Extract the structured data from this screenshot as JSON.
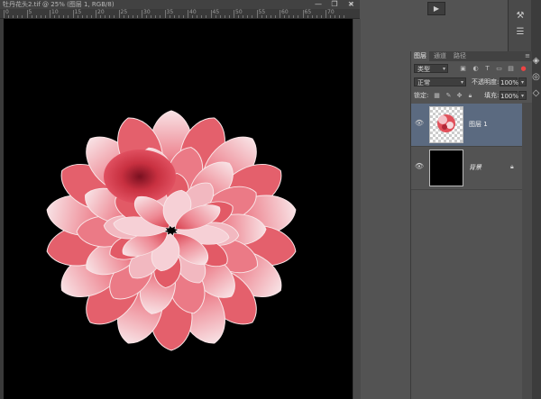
{
  "document": {
    "title": "牡丹花头2.tif @ 25% (图层 1, RGB/8)",
    "ruler_top_labels": [
      "0",
      "5",
      "10",
      "15",
      "20",
      "25",
      "30",
      "35",
      "40",
      "45",
      "50",
      "55",
      "60",
      "65",
      "70"
    ],
    "close_glyph": "×"
  },
  "window_controls": {
    "minimize": "—",
    "restore": "❐",
    "close": "✕"
  },
  "toolbar": {
    "play_glyph": "▶"
  },
  "layers_panel": {
    "tabs": [
      "图层",
      "通道",
      "路径"
    ],
    "active_tab": "图层",
    "menu_glyph": "≡",
    "filter": {
      "kind_label": "类型",
      "icons": [
        "image-filter-icon",
        "adjustment-filter-icon",
        "type-filter-icon",
        "shape-filter-icon",
        "smart-object-filter-icon"
      ]
    },
    "blend_mode": "正常",
    "opacity": {
      "label": "不透明度:",
      "value": "100%"
    },
    "lock": {
      "label": "锁定:"
    },
    "fill": {
      "label": "填充:",
      "value": "100%"
    },
    "layers": [
      {
        "name": "图层 1",
        "selected": true,
        "visible": true
      },
      {
        "name": "背景",
        "selected": false,
        "visible": true,
        "locked": true
      }
    ]
  },
  "colors": {
    "app_bg": "#535353",
    "canvas_bg": "#000000",
    "selected_layer": "#5b6a80",
    "petal_red": "#e0505a",
    "petal_light": "#f6d8dc"
  }
}
